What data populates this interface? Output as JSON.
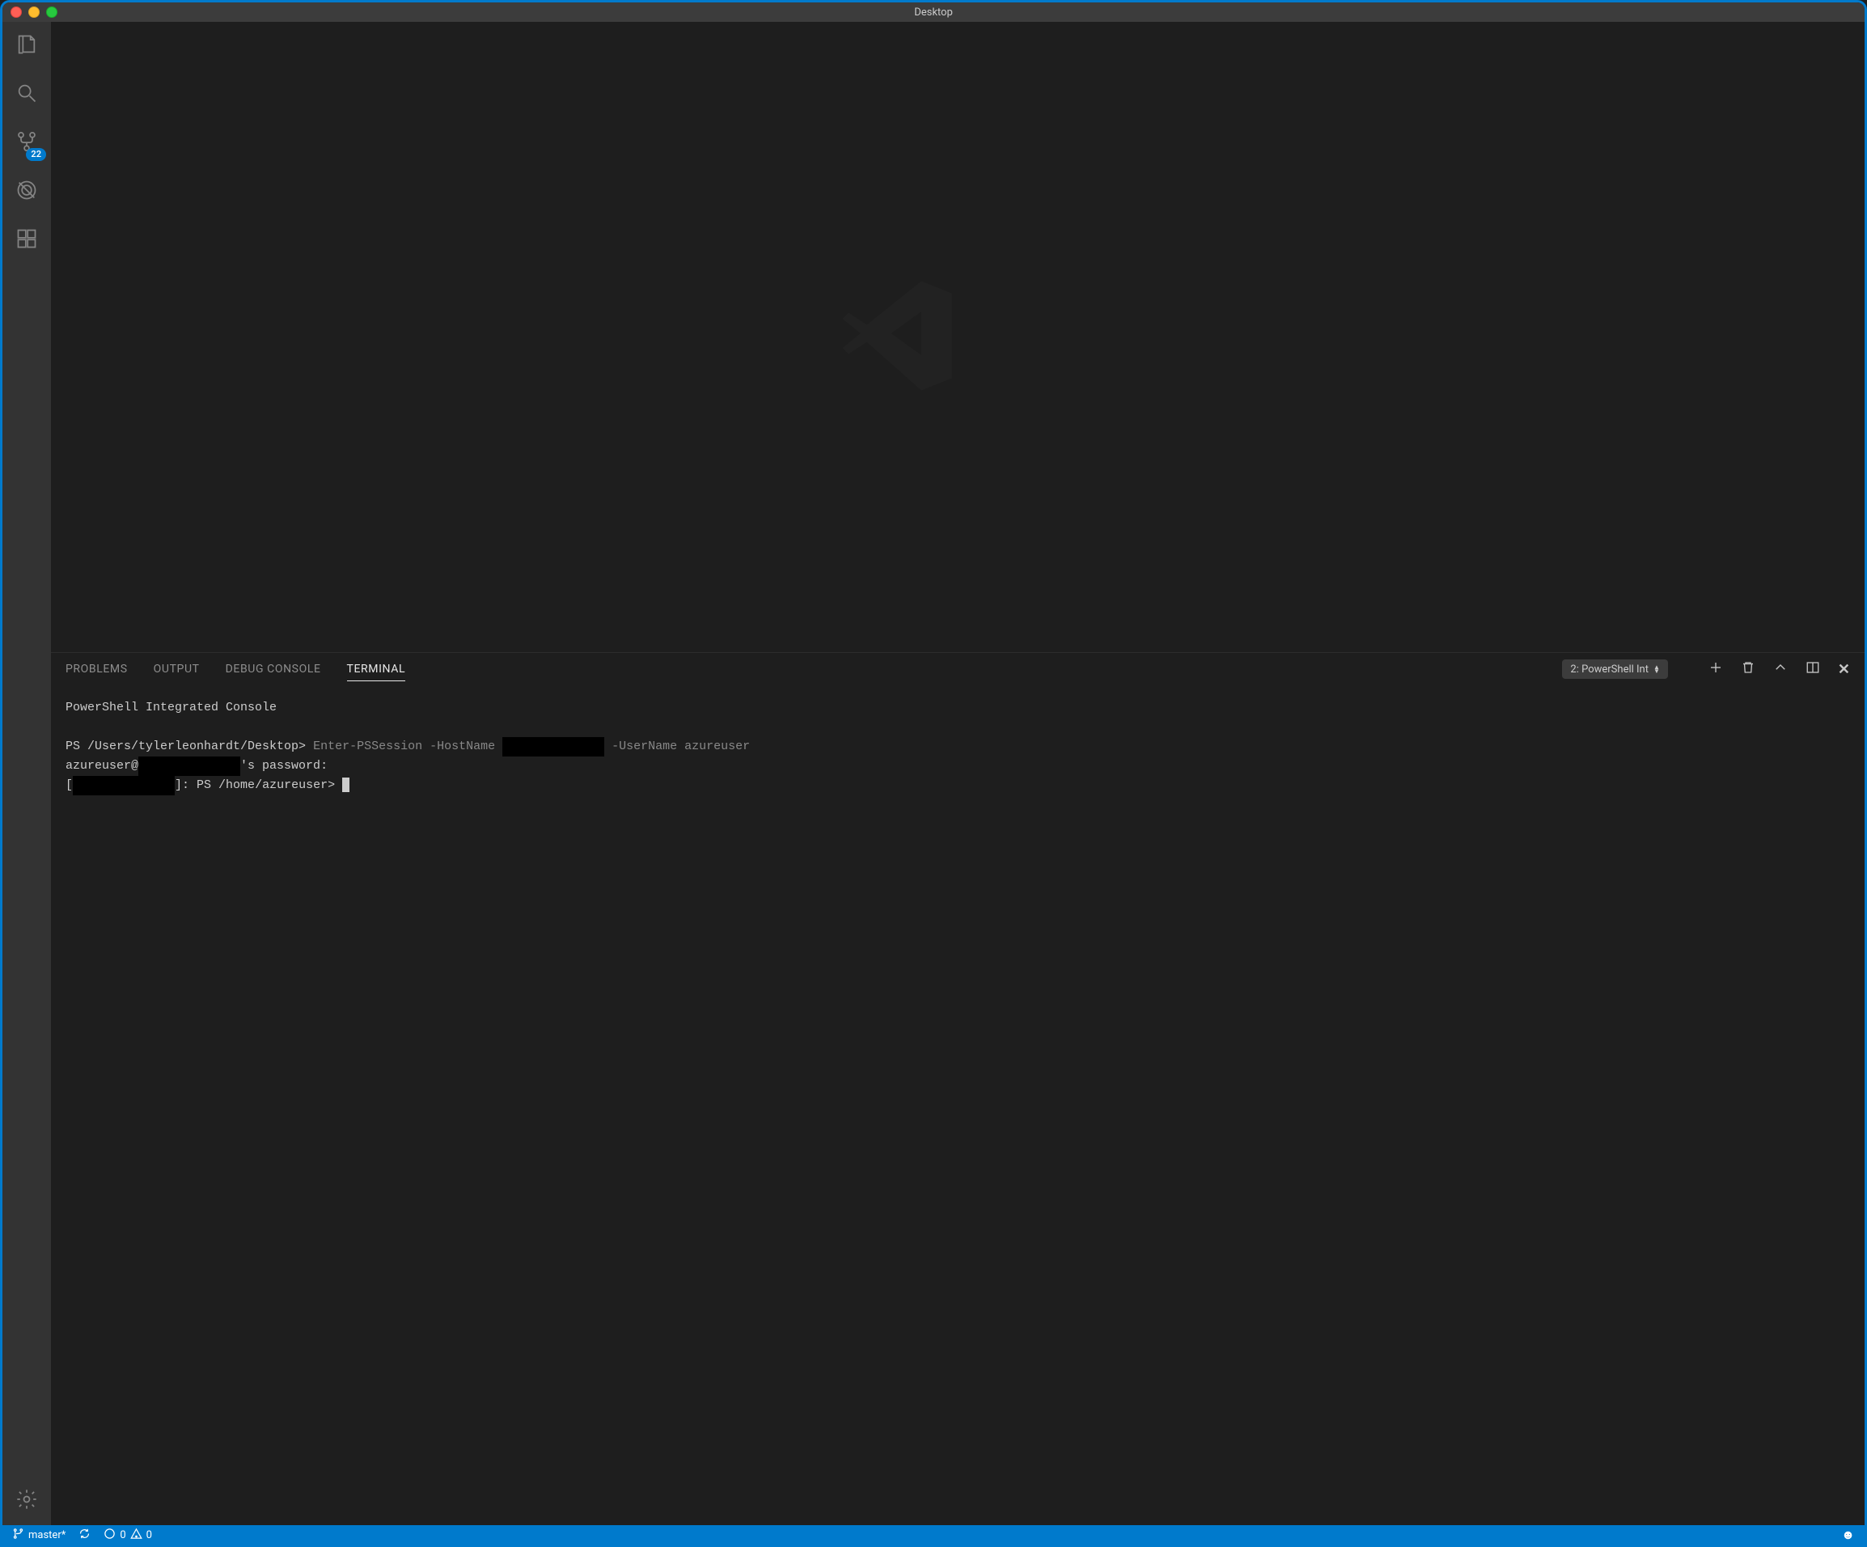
{
  "window": {
    "title": "Desktop"
  },
  "activityBar": {
    "explorer": {
      "icon": "files-icon"
    },
    "search": {
      "icon": "search-icon"
    },
    "scm": {
      "icon": "git-branch-icon",
      "badge": "22"
    },
    "debug": {
      "icon": "bug-icon"
    },
    "extensions": {
      "icon": "extensions-icon"
    },
    "settings": {
      "icon": "gear-icon"
    }
  },
  "panel": {
    "tabs": {
      "problems": "PROBLEMS",
      "output": "OUTPUT",
      "debugConsole": "DEBUG CONSOLE",
      "terminal": "TERMINAL",
      "active": "terminal"
    },
    "terminalPicker": "2: PowerShell Int"
  },
  "terminal": {
    "banner": "PowerShell Integrated Console",
    "line1_prompt": "PS /Users/tylerleonhardt/Desktop>",
    "line1_cmd1": "Enter-PSSession -HostName ",
    "line1_redact1": "              ",
    "line1_cmd2": " -UserName azureuser",
    "line2_pre": "azureuser@",
    "line2_redact": "              ",
    "line2_post": "'s password:",
    "line3_pre": "[",
    "line3_redact": "              ",
    "line3_mid": "]: PS /home/azureuser> "
  },
  "statusBar": {
    "branch": "master*",
    "errors": "0",
    "warnings": "0"
  }
}
